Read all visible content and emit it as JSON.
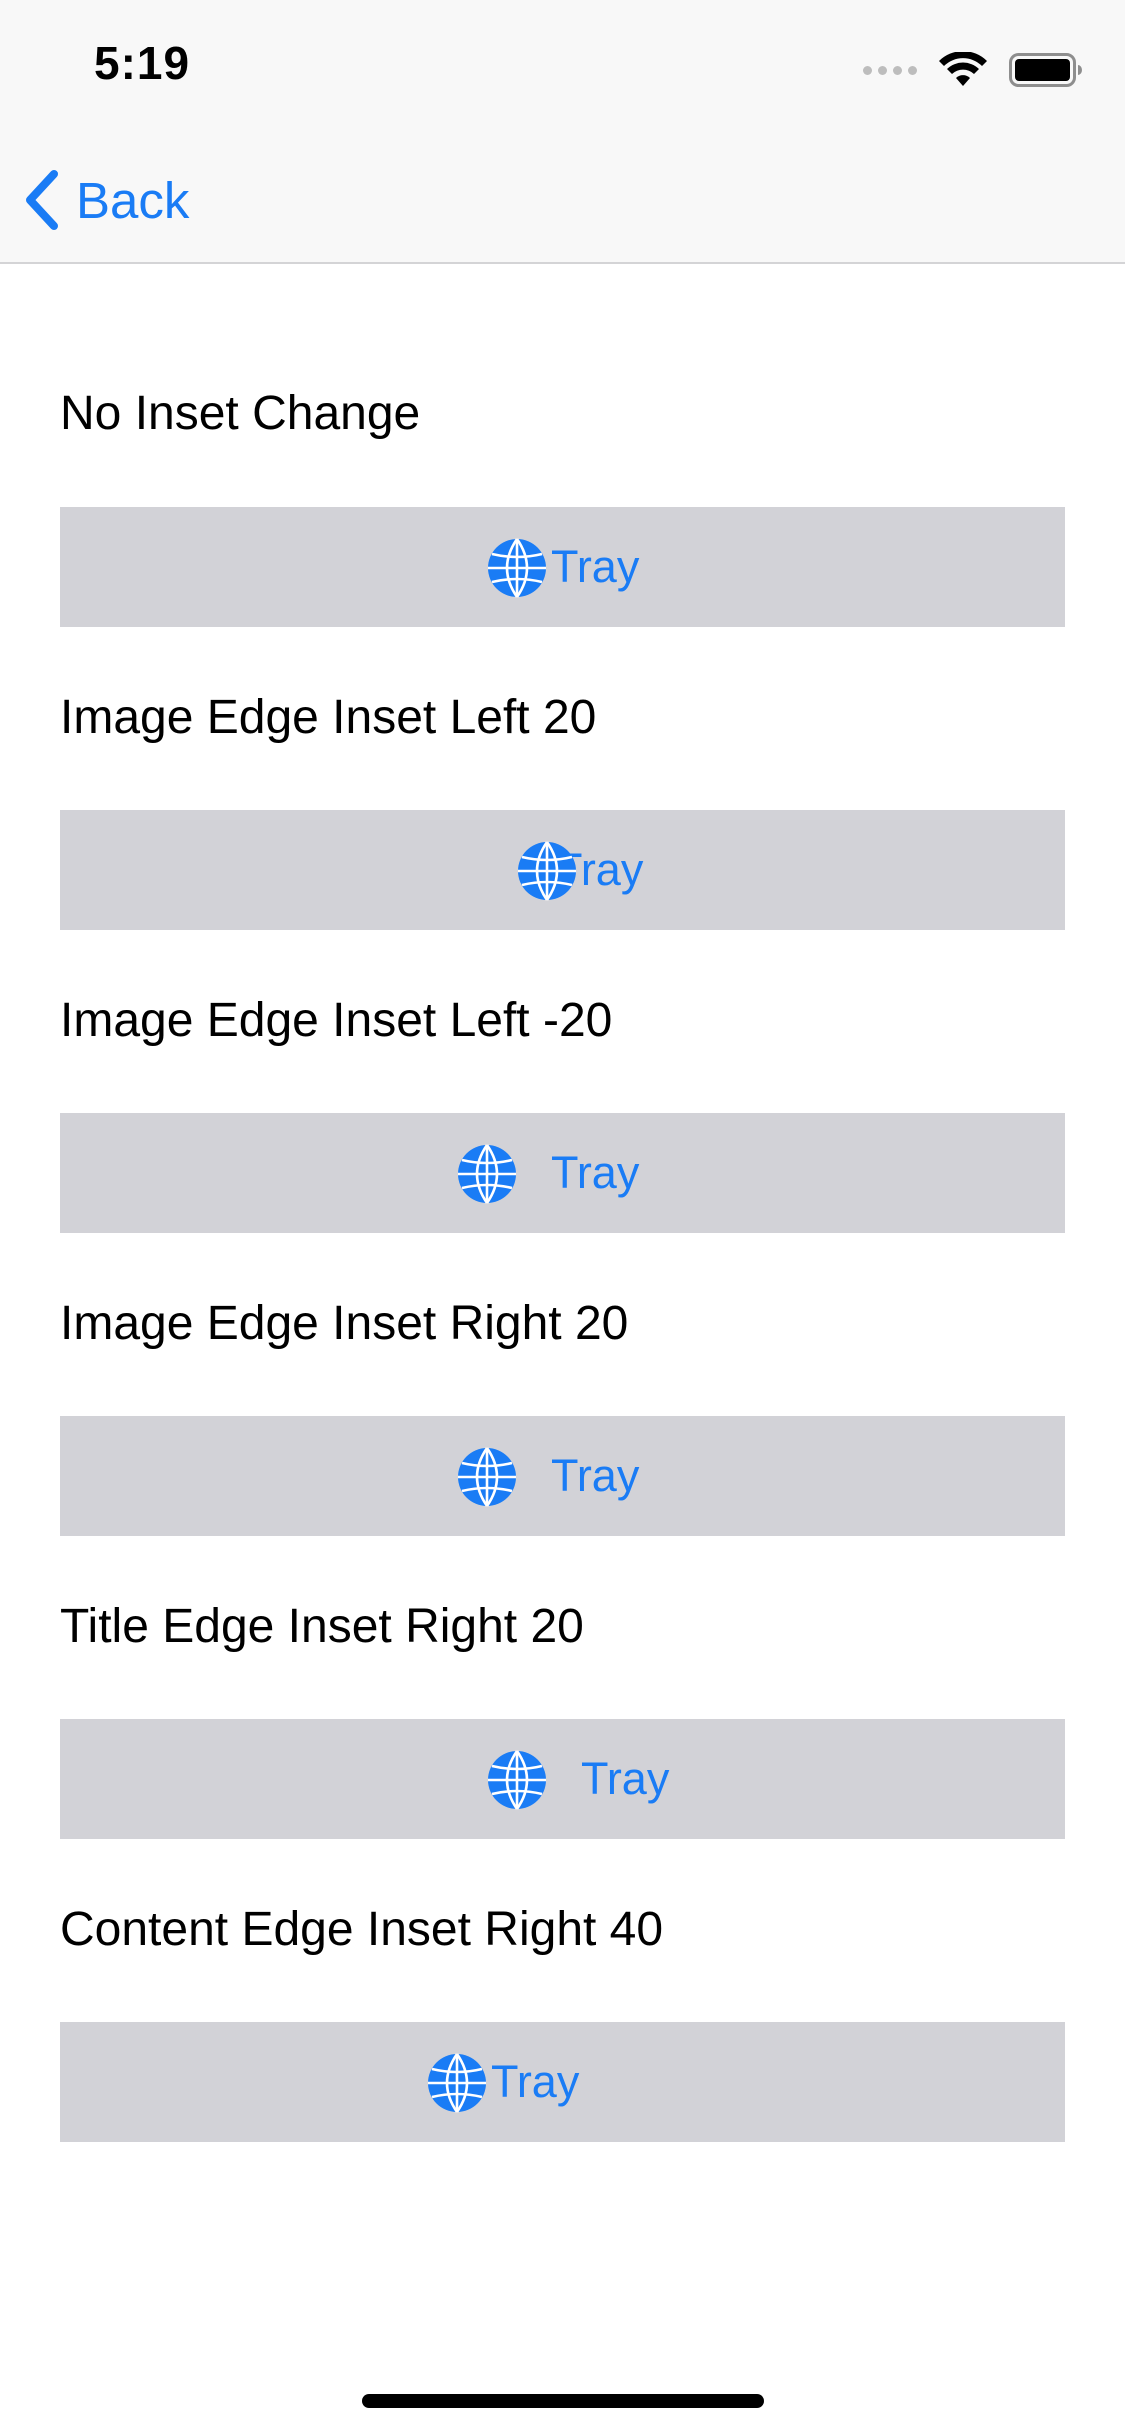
{
  "status_bar": {
    "time": "5:19",
    "icons": [
      "cellular-signal-icon",
      "wifi-icon",
      "battery-icon"
    ]
  },
  "nav": {
    "back_label": "Back"
  },
  "accent_color": "#1a7cf5",
  "button_background": "#d2d2d7",
  "icon": "globe-icon",
  "sections": [
    {
      "label": "No Inset Change",
      "button_title": "Tray"
    },
    {
      "label": "Image Edge Inset Left 20",
      "button_title": "Tray"
    },
    {
      "label": "Image Edge Inset Left -20",
      "button_title": "Tray"
    },
    {
      "label": "Image Edge Inset Right 20",
      "button_title": "Tray"
    },
    {
      "label": "Title Edge Inset Right 20",
      "button_title": "Tray"
    },
    {
      "label": "Content Edge Inset Right 40",
      "button_title": "Tray"
    }
  ]
}
